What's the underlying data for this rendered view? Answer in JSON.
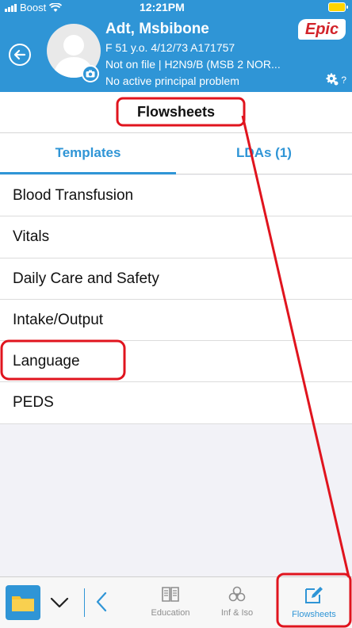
{
  "status_bar": {
    "carrier": "Boost",
    "time": "12:21PM"
  },
  "header": {
    "patient_name": "Adt, Msbibone",
    "demographics": "F 51 y.o. 4/12/73 A171757",
    "location": "Not on file | H2N9/B (MSB 2 NOR...",
    "problem": "No active principal problem",
    "brand": "Epic",
    "help": "?"
  },
  "page": {
    "title": "Flowsheets"
  },
  "tabs": [
    {
      "label": "Templates",
      "active": true
    },
    {
      "label": "LDAs (1)",
      "active": false
    }
  ],
  "templates": [
    {
      "label": "Blood Transfusion"
    },
    {
      "label": "Vitals"
    },
    {
      "label": "Daily Care and Safety"
    },
    {
      "label": "Intake/Output"
    },
    {
      "label": "Language"
    },
    {
      "label": "PEDS"
    }
  ],
  "toolbar": {
    "education_label": "Education",
    "inf_iso_label": "Inf & Iso",
    "flowsheets_label": "Flowsheets"
  },
  "colors": {
    "accent": "#2f95d6",
    "annotation": "#e0141e",
    "brand_red": "#d2232a"
  }
}
